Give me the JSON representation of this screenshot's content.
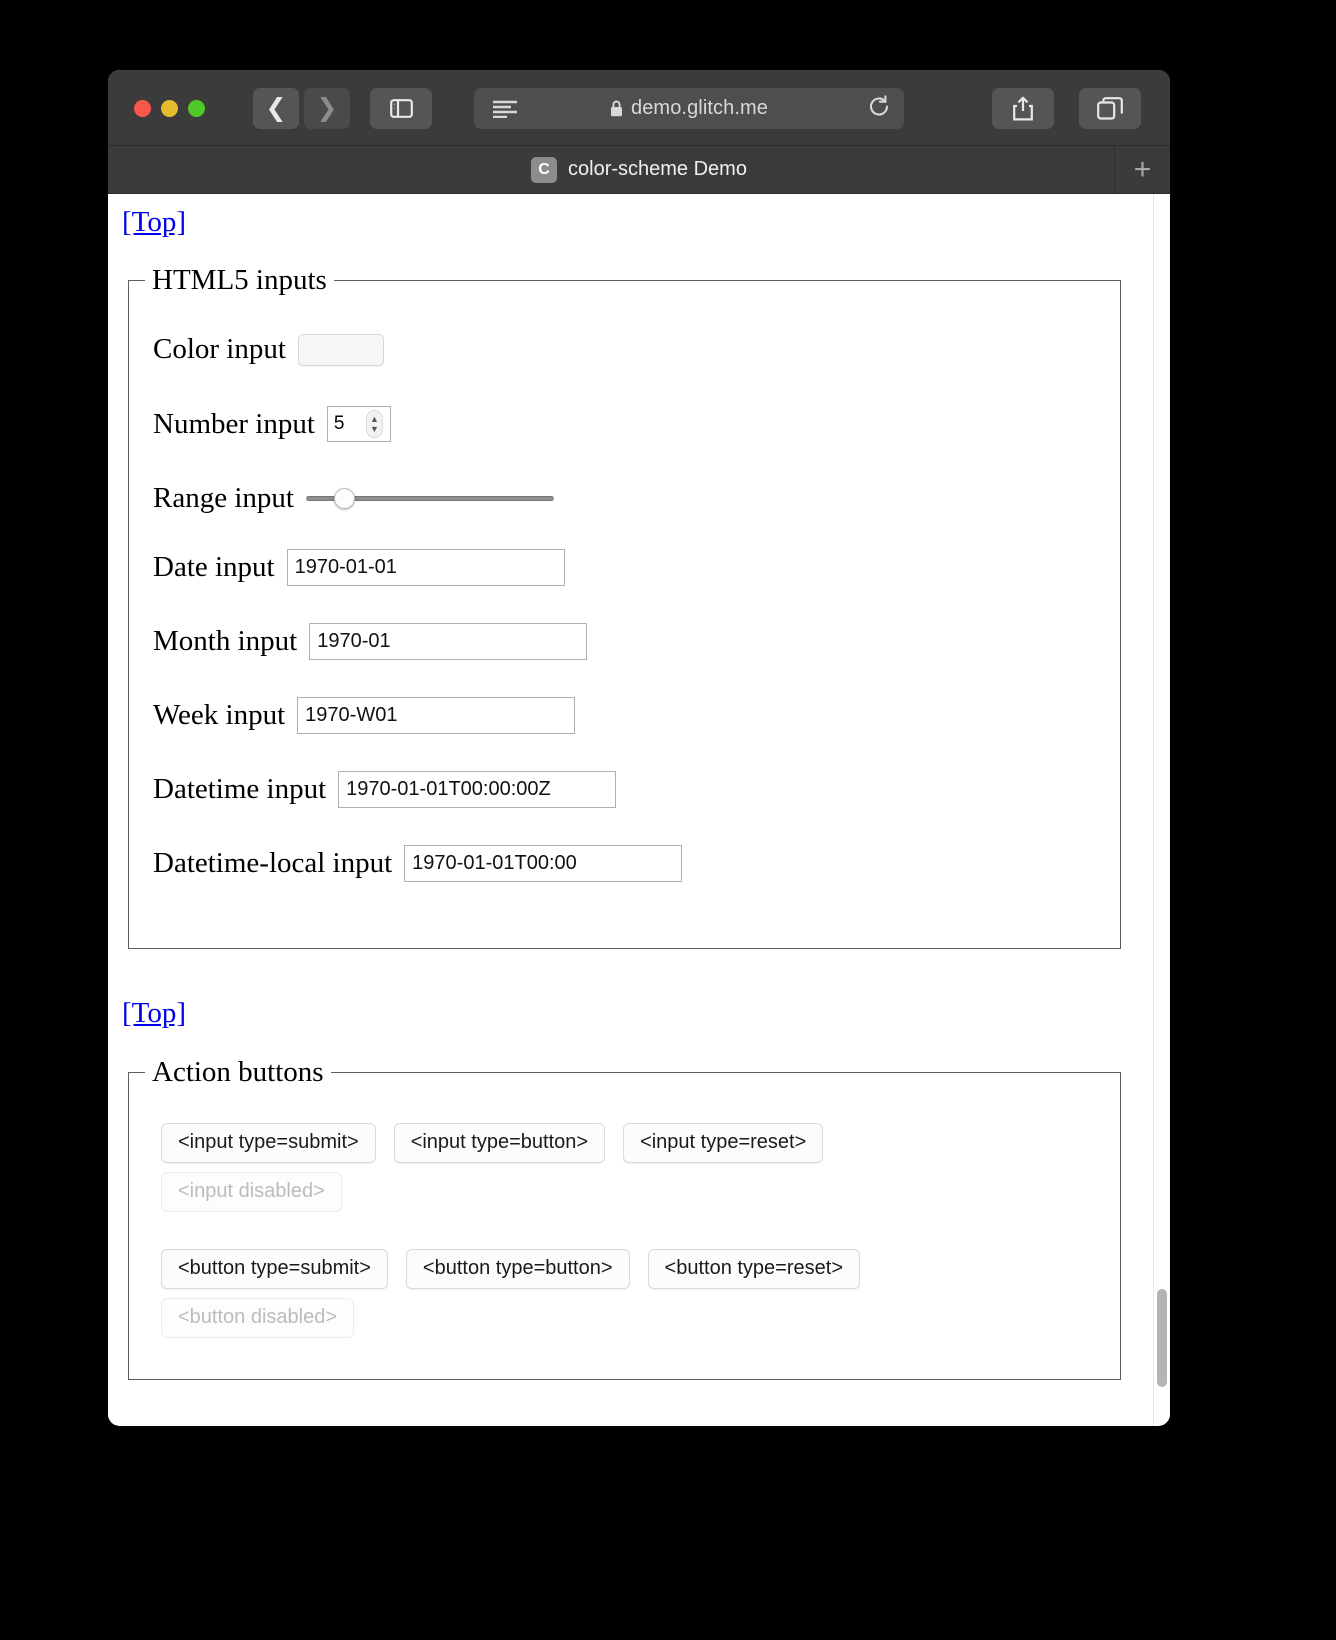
{
  "browser": {
    "url": "demo.glitch.me",
    "lock_icon": "lock-icon",
    "reload_icon": "reload-icon",
    "back_icon": "chevron-left-icon",
    "forward_icon": "chevron-right-icon",
    "sidebar_icon": "sidebar-toggle-icon",
    "reader_icon": "reader-view-icon",
    "share_icon": "share-icon",
    "tab_overview_icon": "tab-overview-icon",
    "new_tab_label": "+",
    "tab": {
      "favicon_letter": "C",
      "title": "color-scheme Demo"
    }
  },
  "page": {
    "top_link_1": "[Top]",
    "top_link_2": "[Top]",
    "fieldsets": [
      {
        "legend": "HTML5 inputs",
        "rows": [
          {
            "label": "Color input",
            "value": "#000000"
          },
          {
            "label": "Number input",
            "value": "5"
          },
          {
            "label": "Range input",
            "value": "15"
          },
          {
            "label": "Date input",
            "value": "1970-01-01"
          },
          {
            "label": "Month input",
            "value": "1970-01"
          },
          {
            "label": "Week input",
            "value": "1970-W01"
          },
          {
            "label": "Datetime input",
            "value": "1970-01-01T00:00:00Z"
          },
          {
            "label": "Datetime-local input",
            "value": "1970-01-01T00:00"
          }
        ]
      },
      {
        "legend": "Action buttons",
        "input_buttons": [
          "<input type=submit>",
          "<input type=button>",
          "<input type=reset>"
        ],
        "input_disabled": "<input disabled>",
        "button_buttons": [
          "<button type=submit>",
          "<button type=button>",
          "<button type=reset>"
        ],
        "button_disabled": "<button disabled>"
      }
    ]
  },
  "colors": {
    "link": "#0000ee",
    "color_swatch": "#000000",
    "toolbar": "#3b3b3b",
    "page_bg": "#ffffff"
  }
}
